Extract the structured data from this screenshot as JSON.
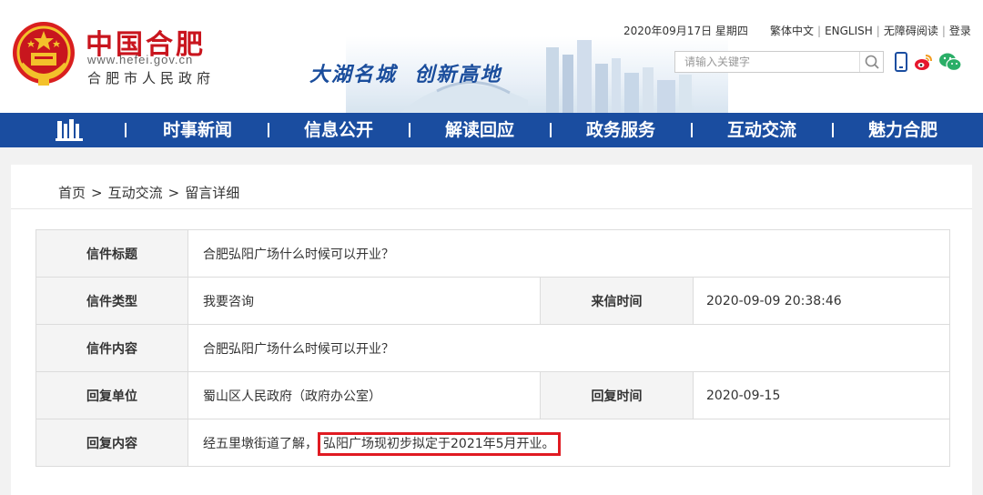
{
  "site": {
    "title": "中国合肥",
    "url": "www.hefei.gov.cn",
    "subtitle": "合肥市人民政府",
    "slogan": "大湖名城  创新高地"
  },
  "topbar": {
    "date": "2020年09月17日 星期四",
    "links": [
      "繁体中文",
      "ENGLISH",
      "无障碍阅读",
      "登录"
    ]
  },
  "search": {
    "placeholder": "请输入关键字"
  },
  "nav": {
    "items": [
      "时事新闻",
      "信息公开",
      "解读回应",
      "政务服务",
      "互动交流",
      "魅力合肥"
    ]
  },
  "breadcrumb": [
    "首页",
    "互动交流",
    "留言详细"
  ],
  "letter": {
    "title_label": "信件标题",
    "title_value": "合肥弘阳广场什么时候可以开业？",
    "type_label": "信件类型",
    "type_value": "我要咨询",
    "time_label": "来信时间",
    "time_value": "2020-09-09 20:38:46",
    "content_label": "信件内容",
    "content_value": "合肥弘阳广场什么时候可以开业？",
    "unit_label": "回复单位",
    "unit_value": "蜀山区人民政府（政府办公室）",
    "reply_time_label": "回复时间",
    "reply_time_value": "2020-09-15",
    "reply_label": "回复内容",
    "reply_prefix": "经五里墩街道了解，",
    "reply_highlight": "弘阳广场现初步拟定于2021年5月开业。"
  },
  "colors": {
    "brand_red": "#c9151e",
    "nav_blue": "#1a4da0",
    "label_blue": "#1a4da0",
    "highlight_red": "#e01b22"
  },
  "icons": [
    "national-emblem-icon",
    "search-icon",
    "mobile-icon",
    "weibo-icon",
    "wechat-icon",
    "home-building-icon"
  ]
}
